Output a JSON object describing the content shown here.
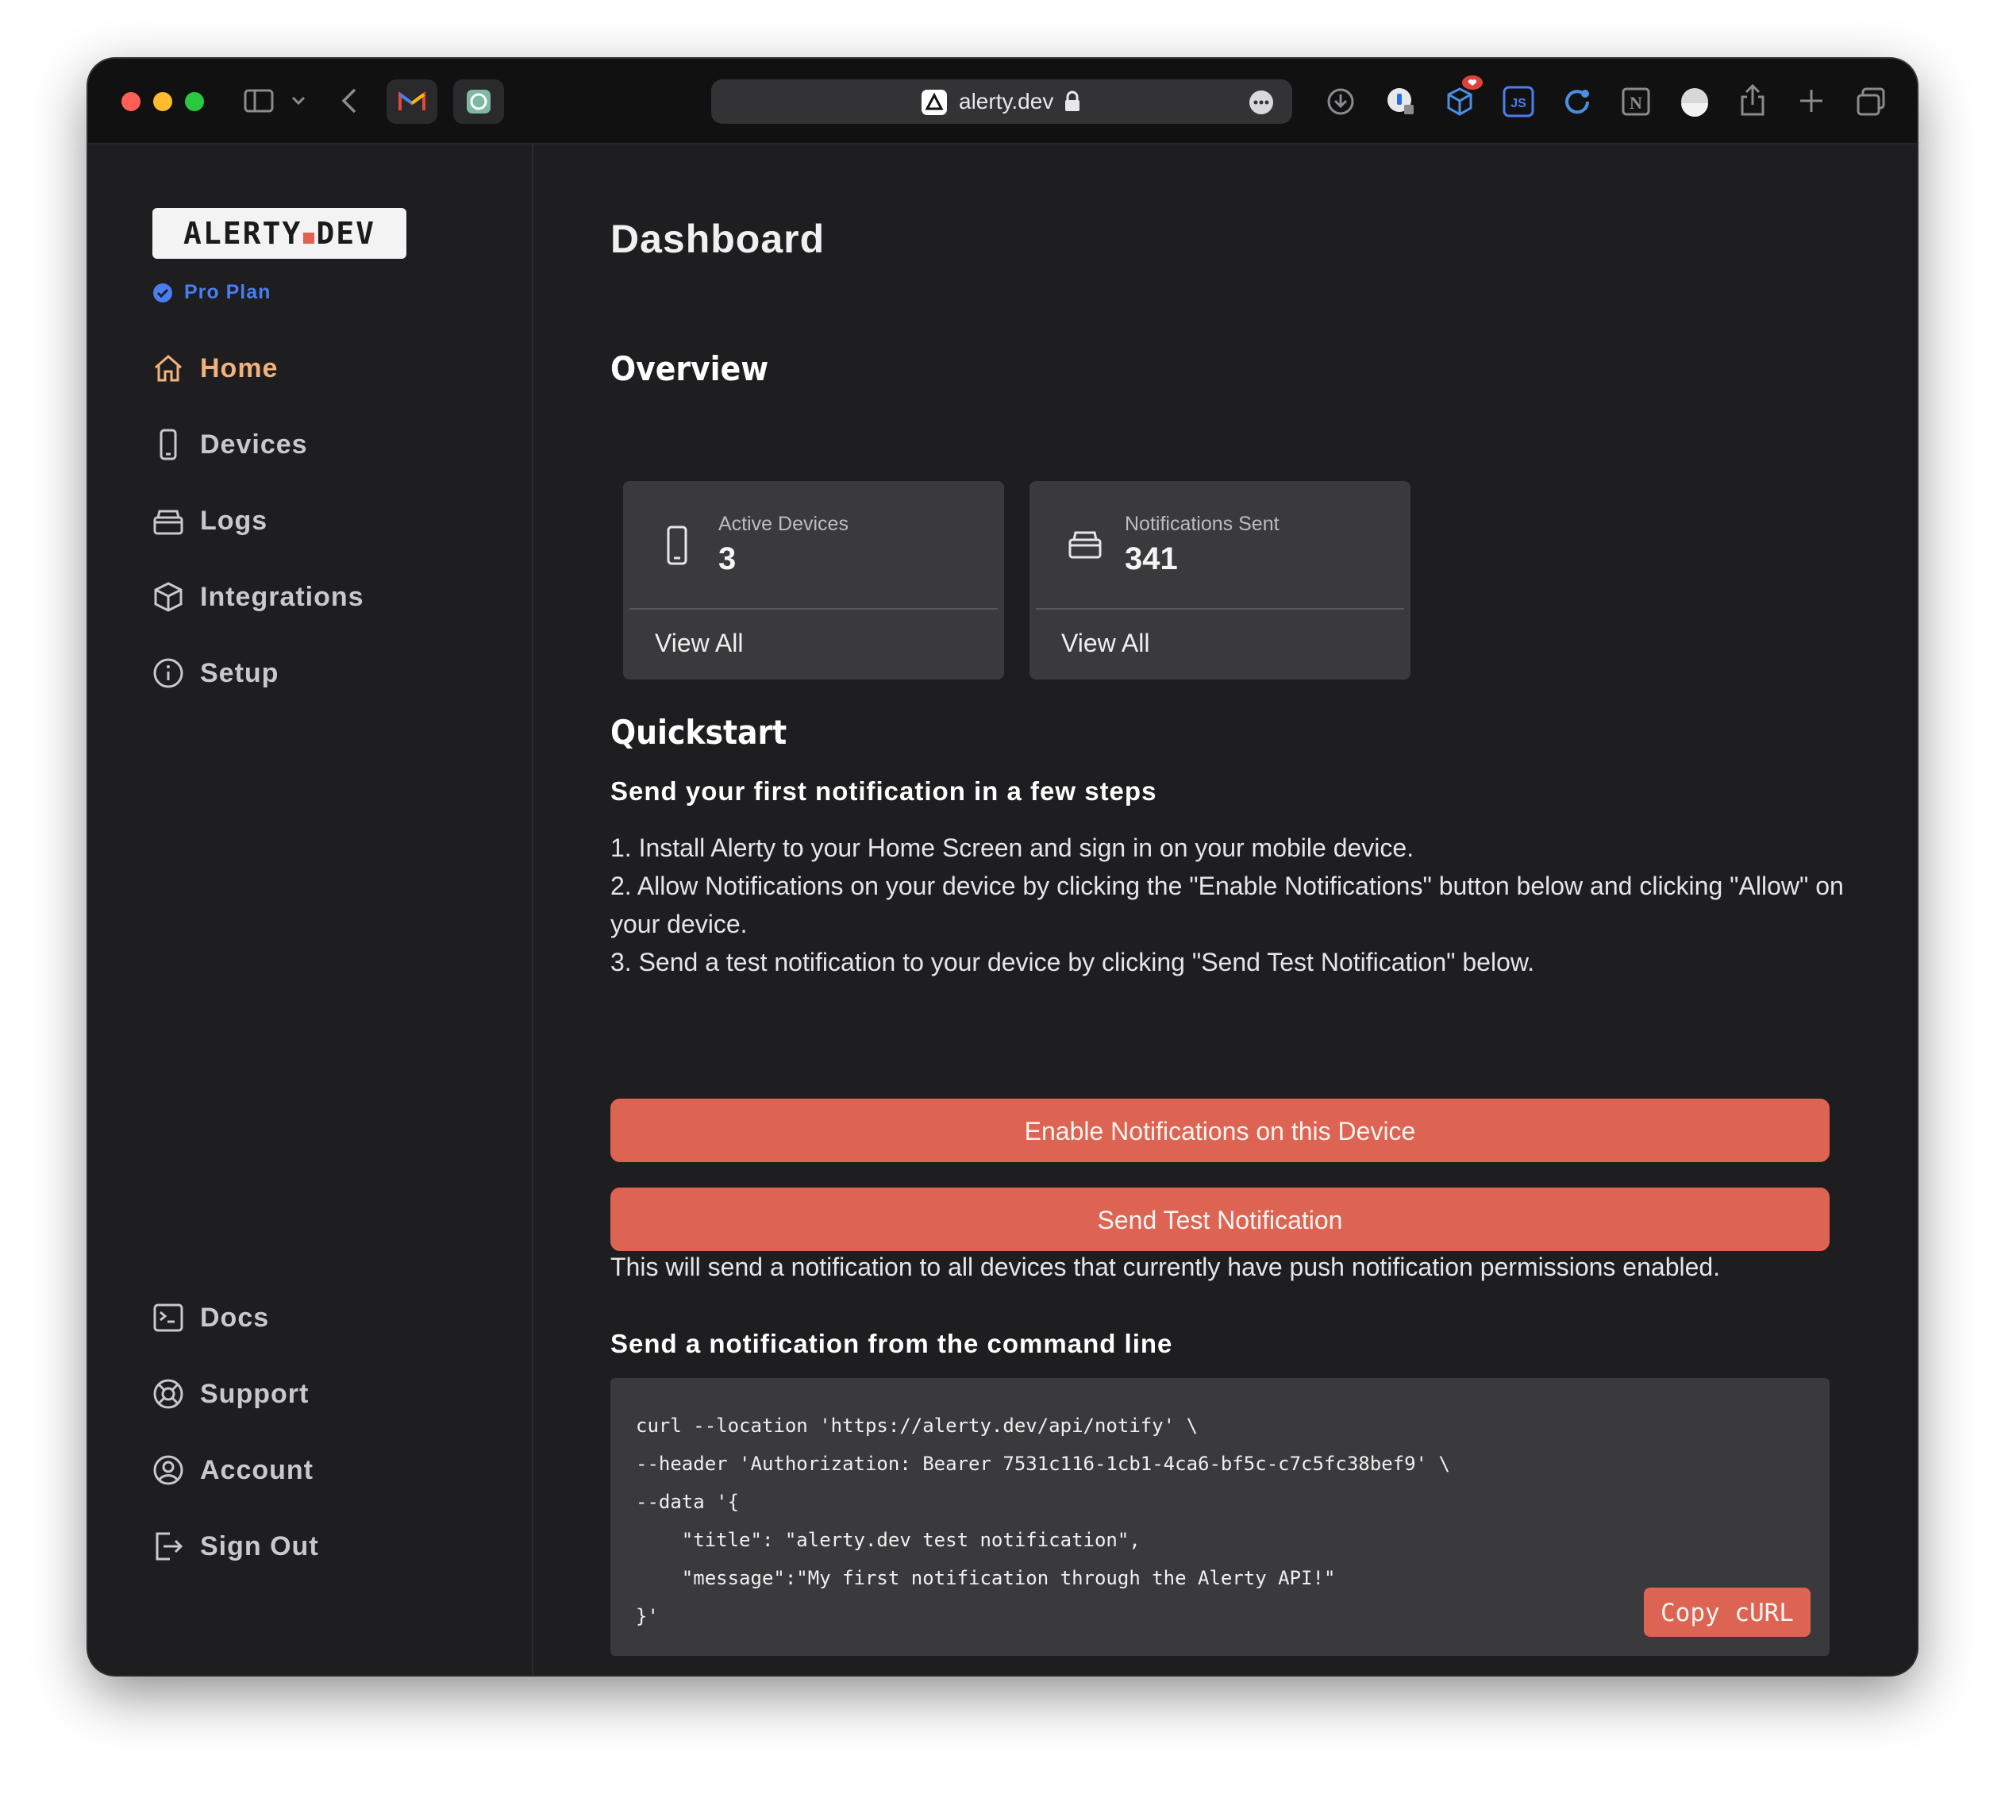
{
  "browser": {
    "address": "alerty.dev"
  },
  "sidebar": {
    "logo": {
      "left": "ALERTY",
      "right": "DEV"
    },
    "plan": "Pro Plan",
    "nav": [
      {
        "label": "Home",
        "icon": "home-icon"
      },
      {
        "label": "Devices",
        "icon": "phone-icon"
      },
      {
        "label": "Logs",
        "icon": "inbox-icon"
      },
      {
        "label": "Integrations",
        "icon": "cube-icon"
      },
      {
        "label": "Setup",
        "icon": "info-icon"
      }
    ],
    "bottom_nav": [
      {
        "label": "Docs",
        "icon": "terminal-icon"
      },
      {
        "label": "Support",
        "icon": "lifebuoy-icon"
      },
      {
        "label": "Account",
        "icon": "user-circle-icon"
      },
      {
        "label": "Sign Out",
        "icon": "sign-out-icon"
      }
    ],
    "colors": {
      "active": "#f3b27a",
      "plan": "#4a7df0"
    }
  },
  "main": {
    "title": "Dashboard",
    "overview": {
      "heading": "Overview",
      "cards": [
        {
          "label": "Active Devices",
          "value": "3",
          "link": "View All",
          "icon": "phone-icon"
        },
        {
          "label": "Notifications Sent",
          "value": "341",
          "link": "View All",
          "icon": "inbox-icon"
        }
      ]
    },
    "quickstart": {
      "heading": "Quickstart",
      "subheading": "Send your first notification in a few steps",
      "steps": [
        "1. Install Alerty to your Home Screen and sign in on your mobile device.",
        "2. Allow Notifications on your device by clicking the \"Enable Notifications\" button below and clicking \"Allow\" on your device.",
        "3. Send a test notification to your device by clicking \"Send Test Notification\" below."
      ],
      "enable_button": "Enable Notifications on this Device",
      "test_button": "Send Test Notification",
      "note": "This will send a notification to all devices that currently have push notification permissions enabled.",
      "cli_heading": "Send a notification from the command line",
      "code_lines": [
        "curl --location 'https://alerty.dev/api/notify' \\",
        "--header 'Authorization: Bearer 7531c116-1cb1-4ca6-bf5c-c7c5fc38bef9' \\",
        "--data '{",
        "    \"title\": \"alerty.dev test notification\",",
        "    \"message\":\"My first notification through the Alerty API!\"",
        "}'"
      ],
      "copy_button": "Copy cURL"
    },
    "colors": {
      "accent": "#dd6453"
    }
  }
}
